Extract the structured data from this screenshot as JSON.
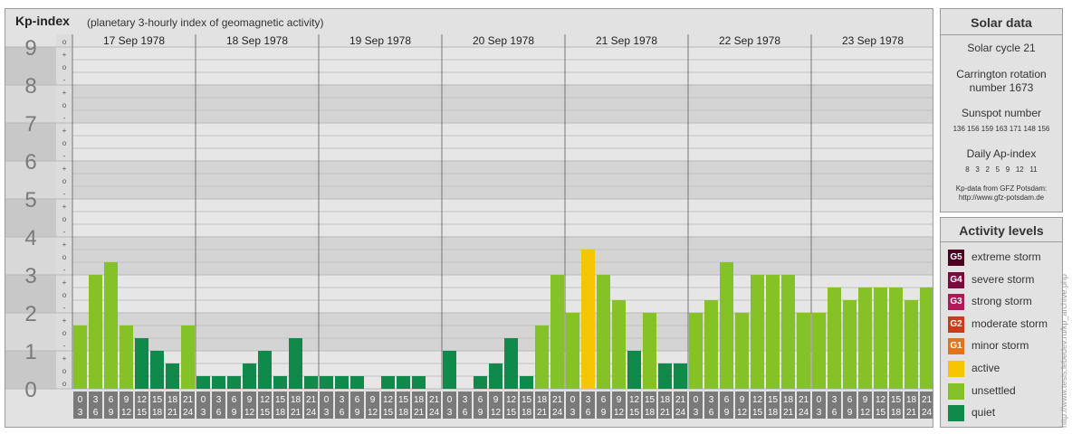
{
  "header": {
    "title": "Kp-index",
    "subtitle": "(planetary 3-hourly index of geomagnetic activity)"
  },
  "chart_data": {
    "type": "bar",
    "ylim": [
      0,
      9
    ],
    "y_ticks": [
      "0",
      "1",
      "2",
      "3",
      "4",
      "5",
      "6",
      "7",
      "8",
      "9"
    ],
    "y_minor_labels": [
      "-",
      "o",
      "+"
    ],
    "days": [
      "17 Sep 1978",
      "18 Sep 1978",
      "19 Sep 1978",
      "20 Sep 1978",
      "21 Sep 1978",
      "22 Sep 1978",
      "23 Sep 1978"
    ],
    "interval_labels": [
      [
        "0",
        "3"
      ],
      [
        "3",
        "6"
      ],
      [
        "6",
        "9"
      ],
      [
        "9",
        "12"
      ],
      [
        "12",
        "15"
      ],
      [
        "15",
        "18"
      ],
      [
        "18",
        "21"
      ],
      [
        "21",
        "24"
      ]
    ],
    "values": [
      1.667,
      3.0,
      3.333,
      1.667,
      1.333,
      1.0,
      0.667,
      1.667,
      0.333,
      0.333,
      0.333,
      0.667,
      1.0,
      0.333,
      1.333,
      0.333,
      0.333,
      0.333,
      0.333,
      0.0,
      0.333,
      0.333,
      0.333,
      0.0,
      1.0,
      0.0,
      0.333,
      0.667,
      1.333,
      0.333,
      1.667,
      3.0,
      2.0,
      3.667,
      3.0,
      2.333,
      1.0,
      2.0,
      0.667,
      0.667,
      2.0,
      2.333,
      3.333,
      2.0,
      3.0,
      3.0,
      3.0,
      2.0,
      2.0,
      2.667,
      2.333,
      2.667,
      2.667,
      2.667,
      2.333,
      2.667
    ],
    "grid": true,
    "legend": "right"
  },
  "solar": {
    "title": "Solar data",
    "cycle": "Solar cycle 21",
    "carrington_line1": "Carrington rotation",
    "carrington_line2": "number 1673",
    "sunspot_label": "Sunspot number",
    "sunspot_values": "136 156 159 163 171 148 156",
    "ap_label": "Daily Ap-index",
    "ap_values": "8   3   2   5   9   12   11",
    "source_line1": "Kp-data from GFZ Potsdam:",
    "source_line2": "http://www.gfz-potsdam.de"
  },
  "activity": {
    "title": "Activity levels",
    "levels": [
      {
        "code": "G5",
        "label": "extreme storm",
        "color": "#4a0020"
      },
      {
        "code": "G4",
        "label": "severe storm",
        "color": "#7a0a40"
      },
      {
        "code": "G3",
        "label": "strong storm",
        "color": "#b0185a"
      },
      {
        "code": "G2",
        "label": "moderate storm",
        "color": "#cc3a1a"
      },
      {
        "code": "G1",
        "label": "minor storm",
        "color": "#e67316"
      },
      {
        "code": "",
        "label": "active",
        "color": "#f7c500"
      },
      {
        "code": "",
        "label": "unsettled",
        "color": "#84c226"
      },
      {
        "code": "",
        "label": "quiet",
        "color": "#0f8a4a"
      }
    ]
  },
  "credit": "http://www.tesis.lebedev.ru/kp_archive.php"
}
